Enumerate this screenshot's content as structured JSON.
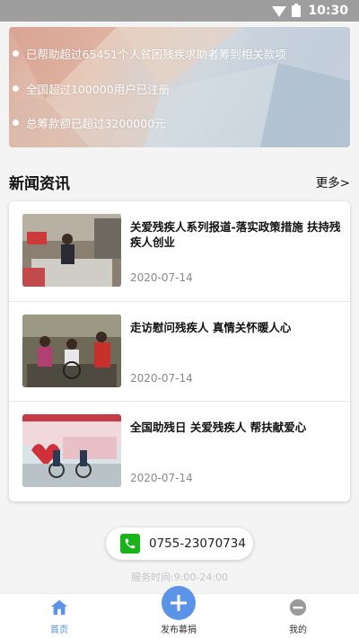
{
  "status_bar": {
    "time": "10:30"
  },
  "banner": {
    "lines": [
      "已帮助超过65451个人贫困残疾求助者筹到相关款项",
      "全国超过100000用户已注册",
      "总筹款额已超过3200000元"
    ]
  },
  "news": {
    "title": "新闻资讯",
    "more": "更多>",
    "items": [
      {
        "title": "关爱残疾人系列报道-落实政策措施 扶持残疾人创业",
        "date": "2020-07-14"
      },
      {
        "title": "走访慰问残疾人 真情关怀暖人心",
        "date": "2020-07-14"
      },
      {
        "title": "全国助残日 关爱残疾人 帮扶献爱心",
        "date": "2020-07-14"
      }
    ]
  },
  "contact": {
    "phone": "0755-23070734",
    "service_hours": "服务时间:9:00-24:00"
  },
  "bottom_nav": {
    "home": "首页",
    "publish": "发布募捐",
    "mine": "我的"
  },
  "colors": {
    "accent": "#4a90e2",
    "publish_button": "#5b93e8",
    "phone_icon": "#1bb31b"
  }
}
